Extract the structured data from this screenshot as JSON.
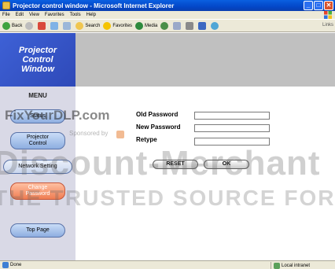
{
  "window": {
    "title": "Projector control window - Microsoft Internet Explorer",
    "buttons": {
      "minimize": "_",
      "maximize": "□",
      "close": "✕"
    }
  },
  "menubar": [
    "File",
    "Edit",
    "View",
    "Favorites",
    "Tools",
    "Help"
  ],
  "toolbar": {
    "back": "Back",
    "search": "Search",
    "favorites": "Favorites",
    "media": "Media",
    "links": "Links"
  },
  "sidebar": {
    "logo_line1": "Projector",
    "logo_line2": "Control",
    "logo_line3": "Window",
    "menu_title": "MENU",
    "status": "Status",
    "projector_control_1": "Projector",
    "projector_control_2": "Control",
    "network_setting": "Network Setting",
    "change_password_1": "Change",
    "change_password_2": "Password",
    "top_page": "Top Page"
  },
  "form": {
    "old_password_label": "Old Password",
    "new_password_label": "New Password",
    "retype_label": "Retype",
    "old_password_value": "",
    "new_password_value": "",
    "retype_value": "",
    "reset_button": "RESET",
    "ok_button": "OK"
  },
  "watermark": {
    "line1": "FixYourDLP.com",
    "line2": "Sponsored by",
    "line3": "Discount-Merchant",
    "line4": "THE TRUSTED SOURCE FOR PRO"
  },
  "statusbar": {
    "status": "Done",
    "zone": "Local intranet"
  }
}
